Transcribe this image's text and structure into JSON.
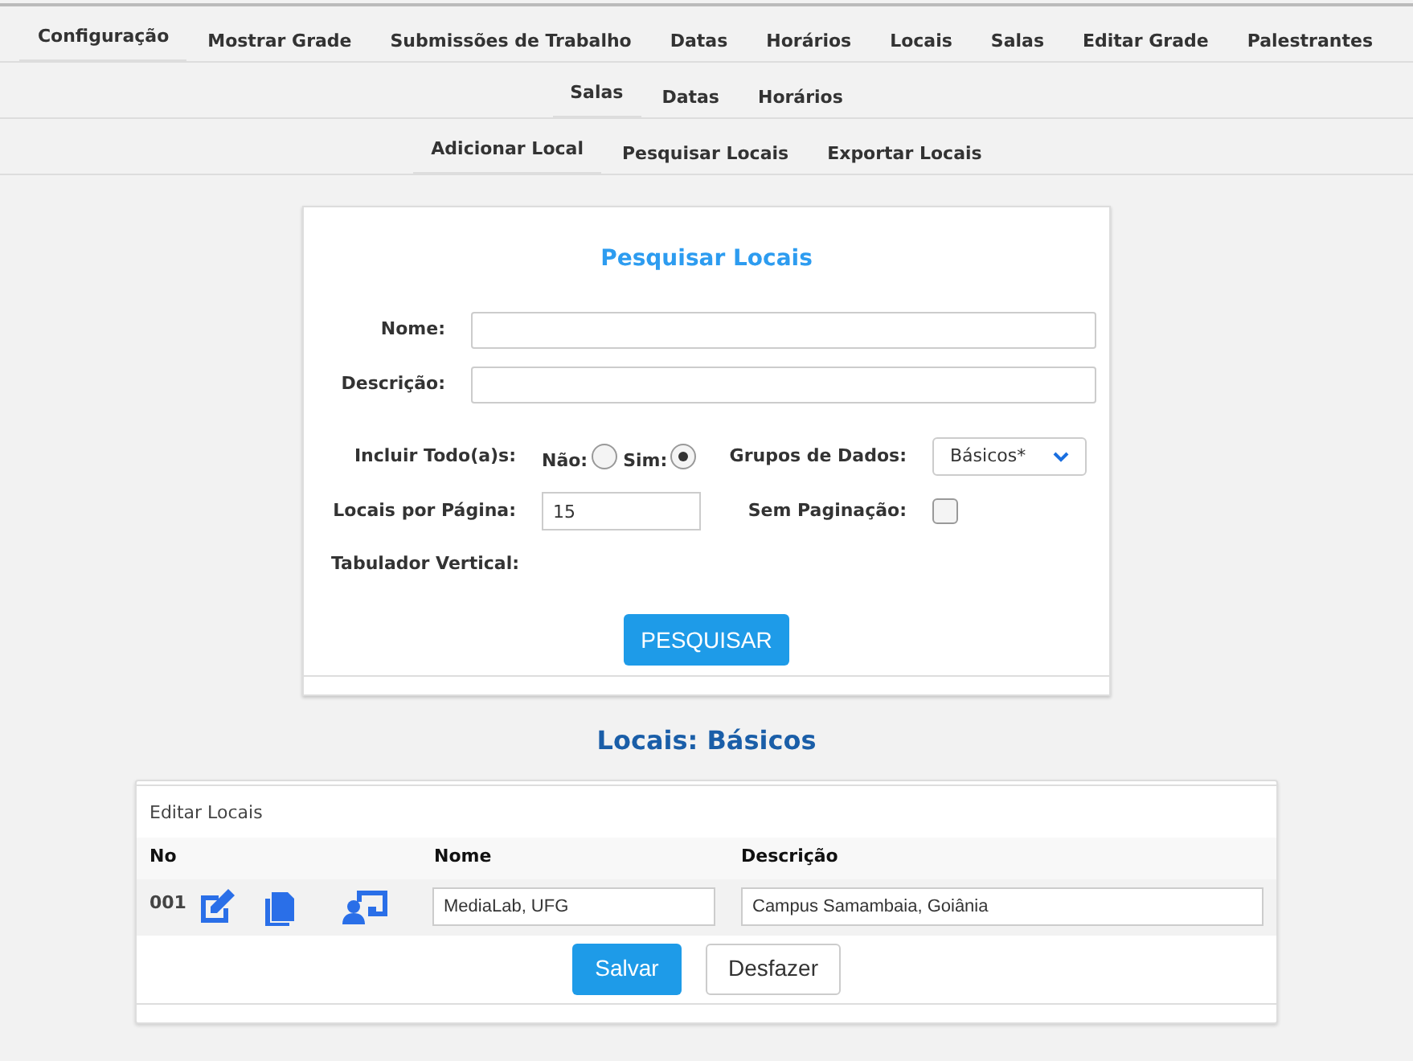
{
  "nav_primary": [
    {
      "label": "Configuração",
      "selected": true
    },
    {
      "label": "Mostrar Grade",
      "selected": false
    },
    {
      "label": "Submissões de Trabalho",
      "selected": false
    },
    {
      "label": "Datas",
      "selected": false
    },
    {
      "label": "Horários",
      "selected": false
    },
    {
      "label": "Locais",
      "selected": false
    },
    {
      "label": "Salas",
      "selected": false
    },
    {
      "label": "Editar Grade",
      "selected": false
    },
    {
      "label": "Palestrantes",
      "selected": false
    }
  ],
  "nav_secondary": [
    {
      "label": "Salas",
      "selected": true
    },
    {
      "label": "Datas",
      "selected": false
    },
    {
      "label": "Horários",
      "selected": false
    }
  ],
  "nav_tertiary": [
    {
      "label": "Adicionar Local",
      "selected": true
    },
    {
      "label": "Pesquisar Locais",
      "selected": false
    },
    {
      "label": "Exportar Locais",
      "selected": false
    }
  ],
  "search_form": {
    "title": "Pesquisar Locais",
    "name_label": "Nome:",
    "description_label": "Descrição:",
    "include_all": {
      "label": "Incluir Todo(a)s:",
      "options": [
        {
          "label": "Não:",
          "selected": false
        },
        {
          "label": "Sim:",
          "selected": true
        }
      ]
    },
    "data_groups": {
      "label": "Grupos de Dados:",
      "value": "Básicos*"
    },
    "per_page": {
      "label": "Locais por Página:",
      "value": "15"
    },
    "no_pagination": {
      "label": "Sem Paginação:",
      "checked": false
    },
    "vertical_tab_label": "Tabulador Vertical:",
    "search_button": "PESQUISAR"
  },
  "results_title": "Locais: Básicos",
  "edit_table": {
    "caption": "Editar Locais",
    "columns": [
      "No",
      "Nome",
      "Descrição"
    ],
    "rows": [
      {
        "no": "001",
        "name": "MediaLab, UFG",
        "description": "Campus Samambaia, Goiânia"
      }
    ],
    "save_button": "Salvar",
    "undo_button": "Desfazer"
  }
}
